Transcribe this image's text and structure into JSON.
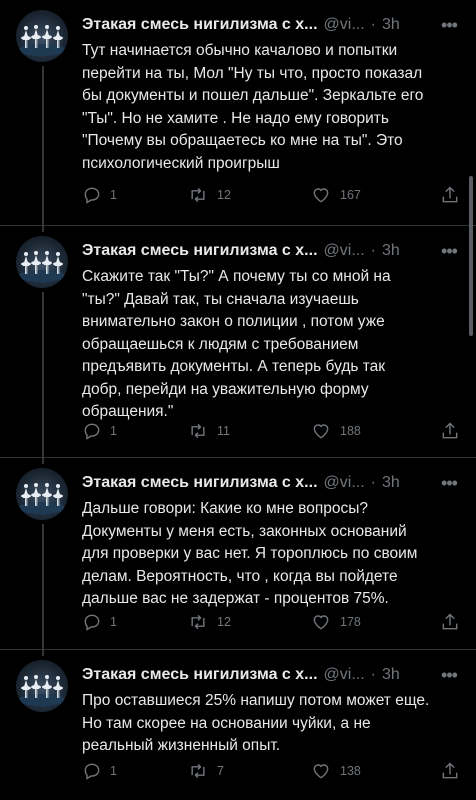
{
  "author": {
    "name": "Этакая смесь нигилизма с х...",
    "handle": "@vi...",
    "separator": "·"
  },
  "tweets": [
    {
      "time": "3h",
      "text": "Тут начинается обычно качалово и попытки\nперейти на ты, Мол \"Ну ты что, просто показал\nбы документы и пошел дальше\". Зеркальте его\n\"Ты\". Но не хамите . Не надо ему говорить\n\"Почему вы обращаетесь ко мне на ты\". Это\nпсихологический проигрыш",
      "replies": "1",
      "retweets": "12",
      "likes": "167"
    },
    {
      "time": "3h",
      "text": "Скажите так \"Ты?\" А почему ты со мной на\n\"ты?\" Давай так, ты сначала изучаешь\nвнимательно закон о полиции , потом уже\nобращаешься к людям с требованием\nпредъявить документы. А теперь будь так\nдобр, перейди на уважительную форму\nобращения.\"",
      "replies": "1",
      "retweets": "11",
      "likes": "188"
    },
    {
      "time": "3h",
      "text": "Дальше говори: Какие ко мне вопросы?\nДокументы у меня есть, законных оснований\nдля проверки у вас нет. Я тороплюсь по своим\nделам. Вероятность, что , когда вы пойдете\nдальше вас не задержат - процентов 75%.",
      "replies": "1",
      "retweets": "12",
      "likes": "178"
    },
    {
      "time": "3h",
      "text": "Про оставшиеся 25% напишу потом может еще.\nНо там скорее на основании чуйки, а не\nреальный жизненный опыт.",
      "replies": "1",
      "retweets": "7",
      "likes": "138"
    }
  ],
  "icons": {
    "avatar": "swan-lake-ballet-avatar",
    "more": "more-dots-icon",
    "reply": "reply-icon",
    "retweet": "retweet-icon",
    "like": "heart-icon",
    "share": "share-icon"
  },
  "colors": {
    "background": "#000000",
    "text": "#e7e9ea",
    "secondary": "#71767b",
    "divider": "#2f3336"
  }
}
